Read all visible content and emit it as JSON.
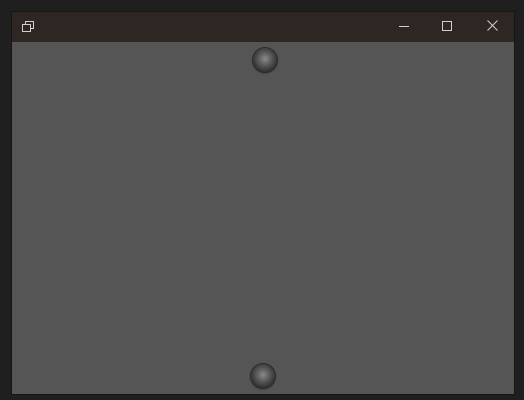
{
  "window": {
    "title": "",
    "accent_color": "#2d2622",
    "client_color": "#555555"
  },
  "titlebar": {
    "app_icon": "restore-windows-icon",
    "buttons": [
      {
        "icon": "minimize-icon"
      },
      {
        "icon": "maximize-icon"
      },
      {
        "icon": "close-icon"
      }
    ]
  },
  "content": {
    "handles": [
      {
        "icon": "drag-handle-top"
      },
      {
        "icon": "drag-handle-bottom"
      }
    ]
  }
}
